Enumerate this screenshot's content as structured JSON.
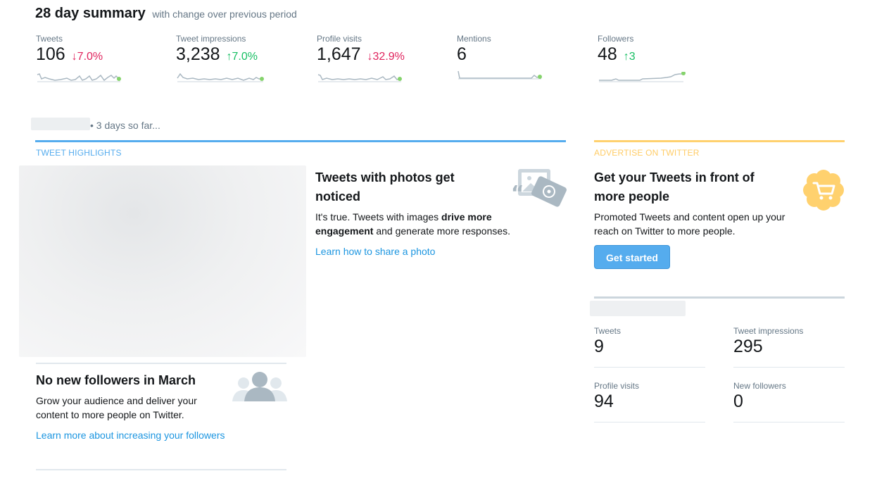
{
  "summary": {
    "title": "28 day summary",
    "subtitle": "with change over previous period",
    "stats": [
      {
        "label": "Tweets",
        "value": "106",
        "arrow": "↓",
        "change": "7.0%",
        "direction": "down"
      },
      {
        "label": "Tweet impressions",
        "value": "3,238",
        "arrow": "↑",
        "change": "7.0%",
        "direction": "up"
      },
      {
        "label": "Profile visits",
        "value": "1,647",
        "arrow": "↓",
        "change": "32.9%",
        "direction": "down"
      },
      {
        "label": "Mentions",
        "value": "6",
        "arrow": "",
        "change": "",
        "direction": "none"
      },
      {
        "label": "Followers",
        "value": "48",
        "arrow": "↑",
        "change": "3",
        "direction": "up"
      }
    ]
  },
  "days_so_far": "• 3 days so far...",
  "highlights": {
    "label": "TWEET HIGHLIGHTS",
    "photos_card": {
      "title": "Tweets with photos get noticed",
      "text_1": "It's true. Tweets with images ",
      "text_bold": "drive more engagement",
      "text_2": " and generate more responses.",
      "link": "Learn how to share a photo"
    },
    "followers_card": {
      "title": "No new followers in March",
      "text": "Grow your audience and deliver your content to more people on Twitter.",
      "link": "Learn more about increasing your followers"
    }
  },
  "advertise": {
    "label": "ADVERTISE ON TWITTER",
    "title": "Get your Tweets in front of more people",
    "text": "Promoted Tweets and content open up your reach on Twitter to more people.",
    "button": "Get started"
  },
  "period_stats": [
    {
      "label": "Tweets",
      "value": "9"
    },
    {
      "label": "Tweet impressions",
      "value": "295"
    },
    {
      "label": "Profile visits",
      "value": "94"
    },
    {
      "label": "New followers",
      "value": "0"
    }
  ],
  "colors": {
    "accent_blue": "#55acee",
    "link_blue": "#1b95e0",
    "advertise_gold": "#ffcc66",
    "down_red": "#e0245e",
    "up_green": "#17bf63"
  }
}
